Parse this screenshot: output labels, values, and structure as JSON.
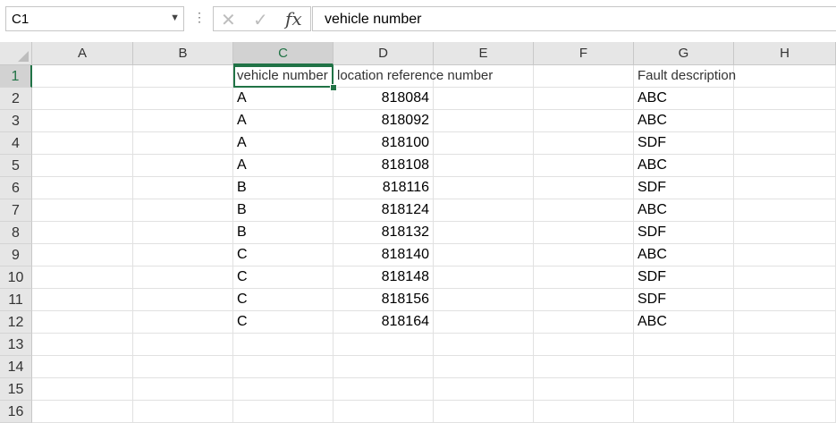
{
  "namebox": {
    "value": "C1"
  },
  "formula": {
    "value": "vehicle number",
    "fx_label": "fx",
    "cancel_glyph": "✕",
    "enter_glyph": "✓",
    "more_glyph": "⋮"
  },
  "columns": [
    "A",
    "B",
    "C",
    "D",
    "E",
    "F",
    "G",
    "H"
  ],
  "selected_column": "C",
  "rows": [
    "1",
    "2",
    "3",
    "4",
    "5",
    "6",
    "7",
    "8",
    "9",
    "10",
    "11",
    "12",
    "13",
    "14",
    "15",
    "16"
  ],
  "selected_row": "1",
  "headers": {
    "c1": "vehicle number",
    "d1": "location reference number",
    "g1": "Fault description"
  },
  "data": [
    {
      "vehicle": "A",
      "location": "818084",
      "fault": "ABC"
    },
    {
      "vehicle": "A",
      "location": "818092",
      "fault": "ABC"
    },
    {
      "vehicle": "A",
      "location": "818100",
      "fault": "SDF"
    },
    {
      "vehicle": "A",
      "location": "818108",
      "fault": "ABC"
    },
    {
      "vehicle": "B",
      "location": "818116",
      "fault": "SDF"
    },
    {
      "vehicle": "B",
      "location": "818124",
      "fault": "ABC"
    },
    {
      "vehicle": "B",
      "location": "818132",
      "fault": "SDF"
    },
    {
      "vehicle": "C",
      "location": "818140",
      "fault": "ABC"
    },
    {
      "vehicle": "C",
      "location": "818148",
      "fault": "SDF"
    },
    {
      "vehicle": "C",
      "location": "818156",
      "fault": "SDF"
    },
    {
      "vehicle": "C",
      "location": "818164",
      "fault": "ABC"
    }
  ],
  "colors": {
    "accent": "#217346",
    "header_bg": "#e6e6e6",
    "header_selected_bg": "#d2d2d2",
    "gridline": "#e1e1e1"
  }
}
